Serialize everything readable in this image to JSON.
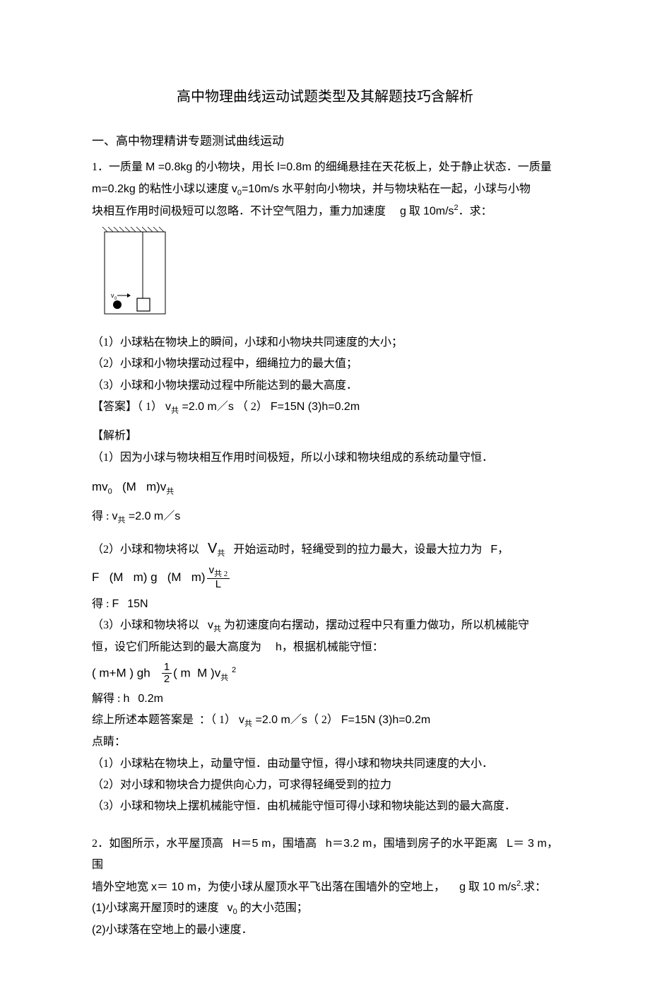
{
  "title": "高中物理曲线运动试题类型及其解题技巧含解析",
  "section1": "一、高中物理精讲专题测试曲线运动",
  "q1": {
    "line1a": "1．一质量 ",
    "line1b": "M =0.8kg",
    "line1c": " 的小物块，用长 ",
    "line1d": "l=0.8m",
    "line1e": " 的细绳悬挂在天花板上，处于静止状态．一质量",
    "line2a": "m=0.2kg",
    "line2b": " 的粘性小球以速度 ",
    "line2c": "v",
    "line2d": "0",
    "line2e": "=10m/s",
    "line2f": " 水平射向小物块，并与物块粘在一起，小球与小物",
    "line3a": "块相互作用时间极短可以忽略．不计空气阻力，重力加速度",
    "line3b": "g",
    "line3c": " 取 ",
    "line3d": "10m/s",
    "line3e": "2",
    "line3f": "．求：",
    "p1": "（1）小球粘在物块上的瞬间，小球和小物块共同速度的大小；",
    "p2": "（2）小球和小物块摆动过程中，细绳拉力的最大值；",
    "p3": "（3）小球和小物块摆动过程中所能达到的最大高度．",
    "ans_label": "【答案】",
    "ans1a": "（ 1） ",
    "ans1b": "v",
    "ans1c": "共",
    "ans1d": " =2.0 m／s",
    "ans2a": " （ 2）  ",
    "ans2b": "F=15N  (3)h=0.2m",
    "analysis_label": "【解析】",
    "a1": "（1）因为小球与物块相互作用时间极短，所以小球和物块组成的系统动量守恒．",
    "f1a": "mv",
    "f1b": "0",
    "f1c": "(M",
    "f1d": "m)v",
    "f1e": "共",
    "r1a": "得 : ",
    "r1b": "v",
    "r1c": "共",
    "r1d": " =2.0 m／s",
    "a2a": "（2）小球和物块将以",
    "a2b": "V",
    "a2c": "共",
    "a2d": "开始运动时，轻绳受到的拉力最大，设最大拉力为",
    "a2e": "F",
    "a2f": "，",
    "f2a": "F",
    "f2b": "(M",
    "f2c": "m) g",
    "f2d": "(M",
    "f2e": "m)",
    "f2num": "v",
    "f2numsub": "共 2",
    "f2den": "L",
    "r2a": "得 : ",
    "r2b": "F",
    "r2c": "15N",
    "a3a": "（3）小球和物块将以",
    "a3b": "v",
    "a3c": "共",
    "a3d": " 为初速度向右摆动，摆动过程中只有重力做功，所以机械能守",
    "a3e": "恒，设它们所能达到的最大高度为",
    "a3f": "h",
    "a3g": "，根据机械能守恒：",
    "f3a": "( m+M ) gh",
    "f3num": "1",
    "f3den": "2",
    "f3b": "( m",
    "f3c": "M )v",
    "f3d": "共",
    "f3e": "2",
    "r3a": "解得 : ",
    "r3b": "h",
    "r3c": "0.2m",
    "sum_a": "综上所述本题答案是",
    "sum_b": "：（ 1） ",
    "sum_c": "v",
    "sum_d": "共",
    "sum_e": " =2.0 m／s",
    "sum_f": "（ 2） ",
    "sum_g": "F=15N  (3)h=0.2m",
    "hint_label": "点睛：",
    "h1": "（1）小球粘在物块上，动量守恒．由动量守恒，得小球和物块共同速度的大小．",
    "h2": "（2）对小球和物块合力提供向心力，可求得轻绳受到的拉力",
    "h3": "（3）小球和物块上摆机械能守恒．由机械能守恒可得小球和物块能达到的最大高度．"
  },
  "q2": {
    "l1a": "2．如图所示，水平屋顶高",
    "l1b": "H＝5 m",
    "l1c": "，围墙高",
    "l1d": "h＝3.2 m",
    "l1e": "，围墙到房子的水平距离",
    "l1f": "L＝ 3 m",
    "l1g": "，围",
    "l2a": "墙外空地宽 ",
    "l2b": "x＝ 10 m",
    "l2c": "，为使小球从屋顶水平飞出落在围墙外的空地上，",
    "l2d": "g",
    "l2e": " 取 ",
    "l2f": "10 m/s",
    "l2g": "2",
    "l2h": ".求：",
    "p1a": "(1)",
    "p1b": "小球离开屋顶时的速度",
    "p1c": "v",
    "p1d": "0",
    "p1e": " 的大小范围；",
    "p2a": "(2)",
    "p2b": "小球落在空地上的最小速度．"
  }
}
